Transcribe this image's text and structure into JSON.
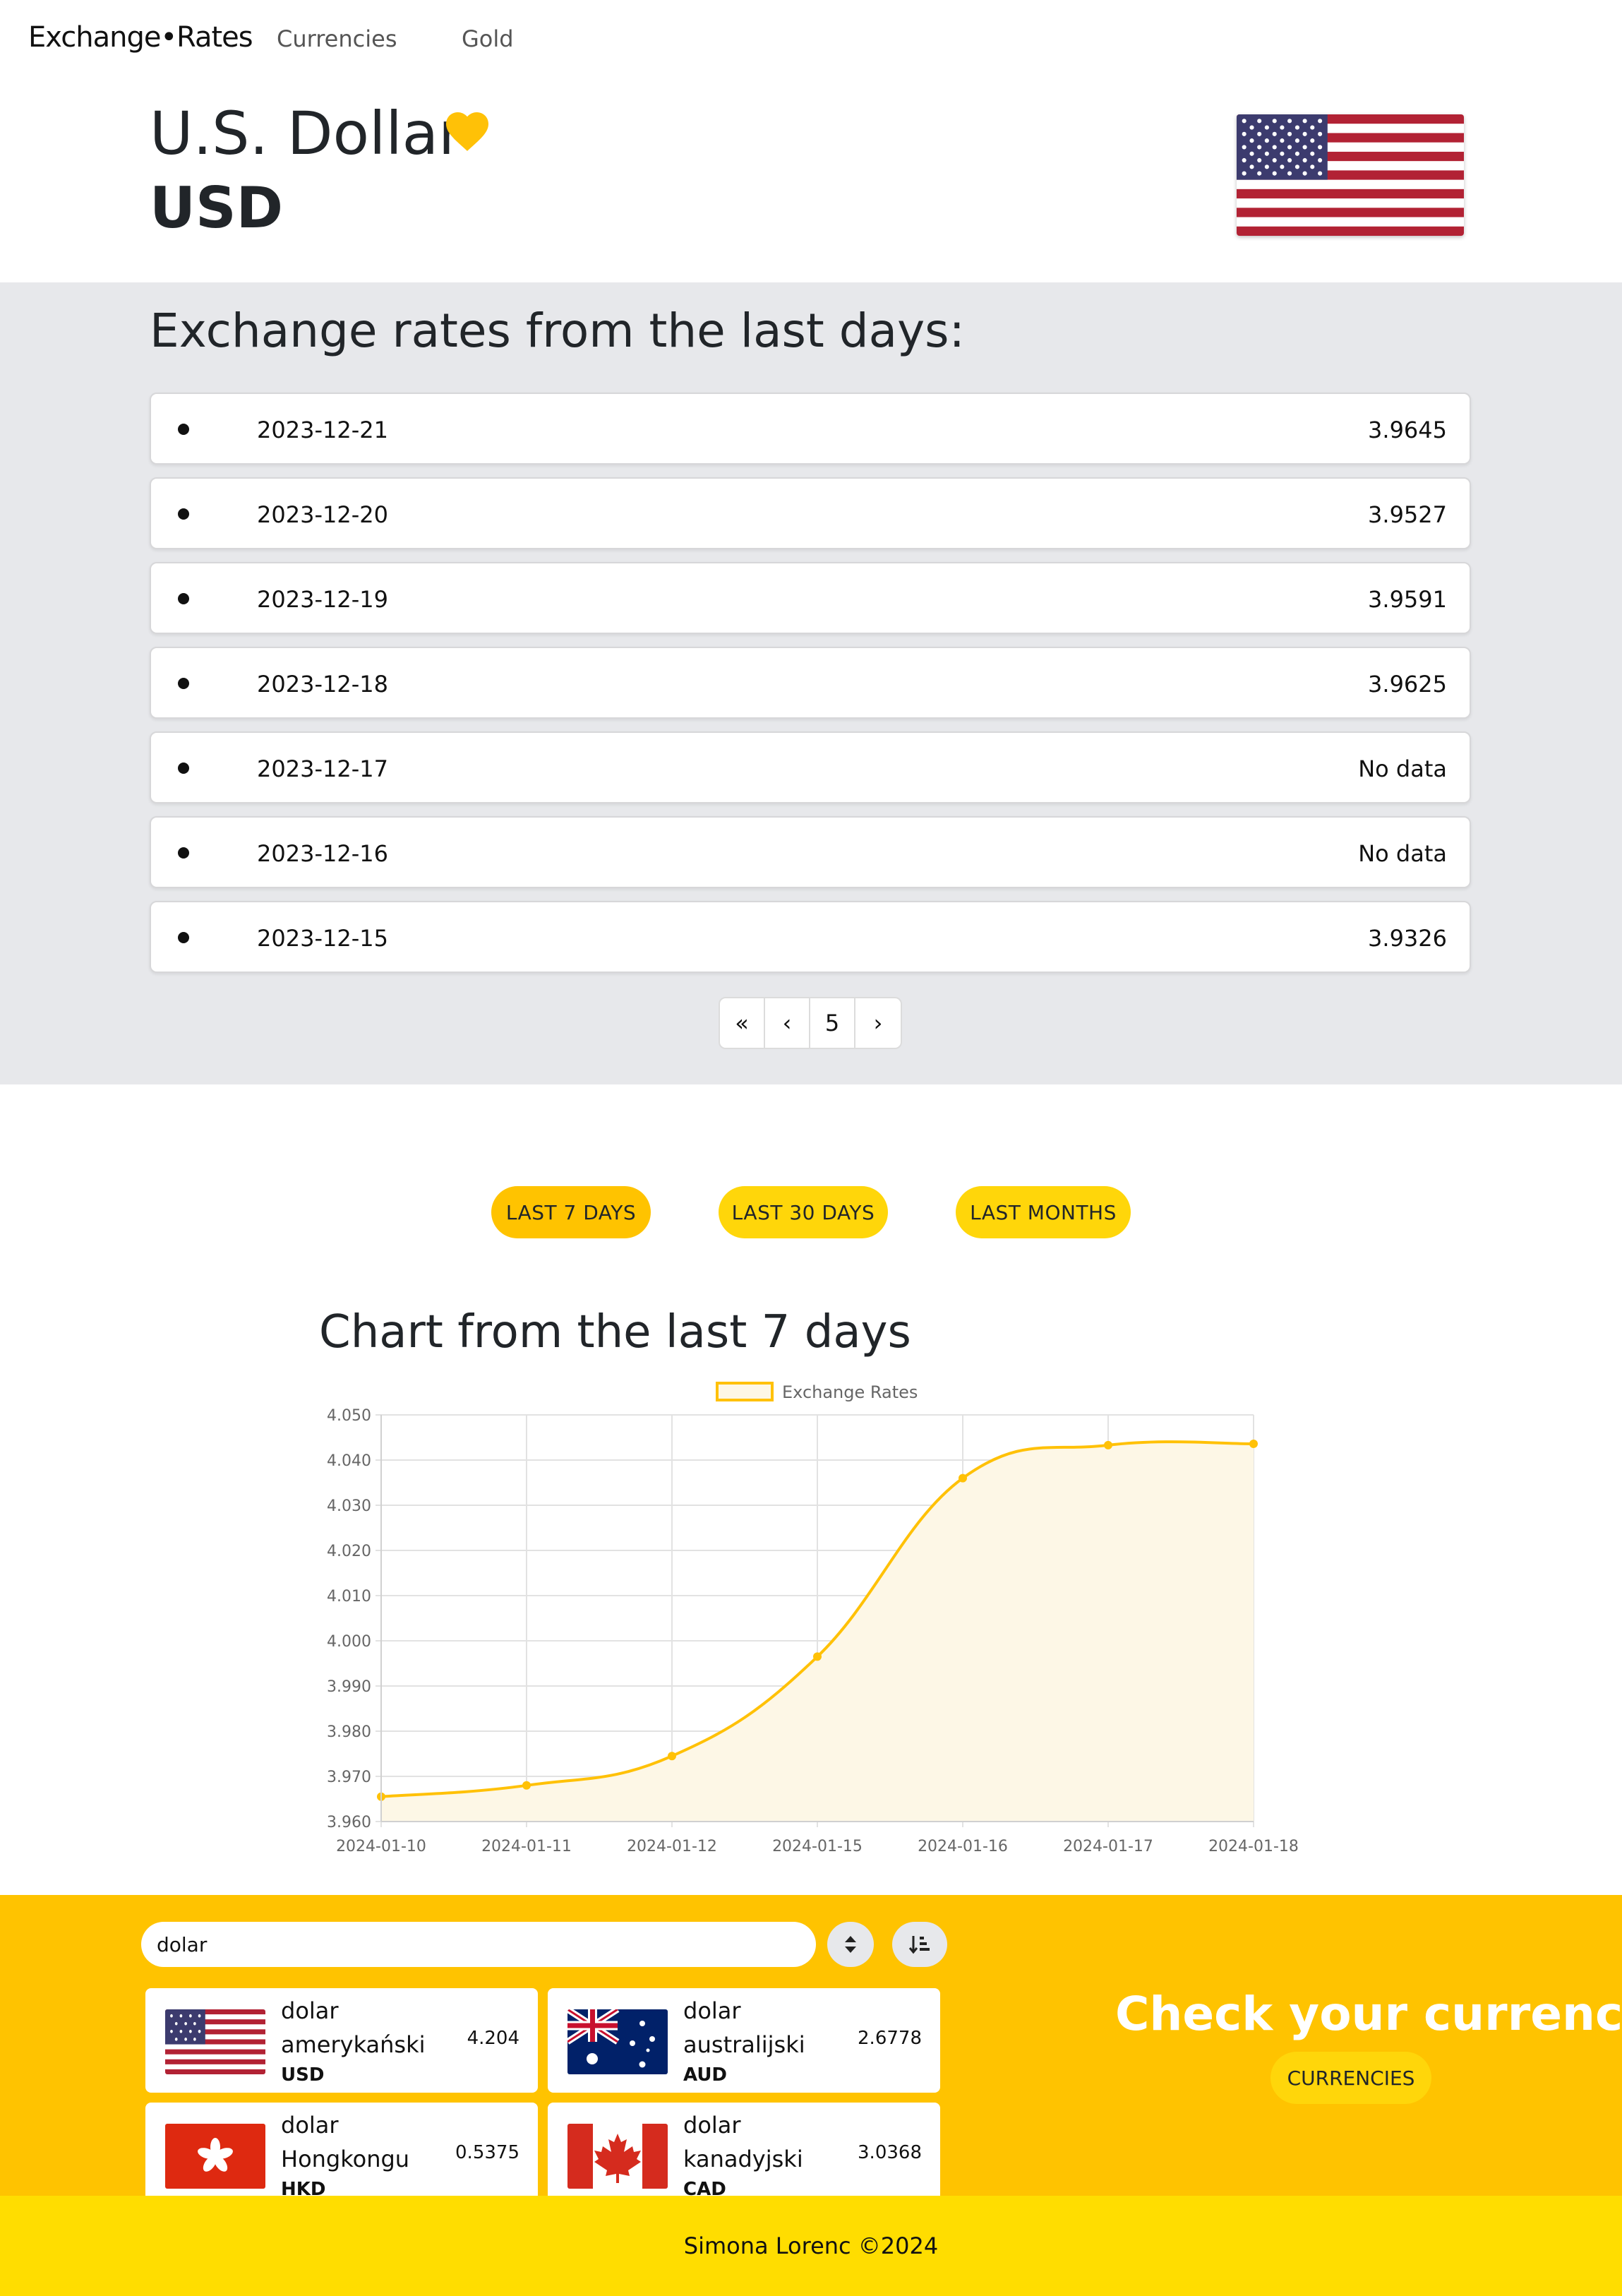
{
  "nav": {
    "brand": "Exchange•Rates",
    "links": [
      "Currencies",
      "Gold"
    ]
  },
  "currency": {
    "name": "U.S. Dollar",
    "code": "USD",
    "flag_icon": "us-flag-icon",
    "favorite_icon": "heart-icon",
    "favorite_color": "#ffc107"
  },
  "rates": {
    "title": "Exchange rates from the last days:",
    "rows": [
      {
        "date": "2023-12-21",
        "value": "3.9645"
      },
      {
        "date": "2023-12-20",
        "value": "3.9527"
      },
      {
        "date": "2023-12-19",
        "value": "3.9591"
      },
      {
        "date": "2023-12-18",
        "value": "3.9625"
      },
      {
        "date": "2023-12-17",
        "value": "No data"
      },
      {
        "date": "2023-12-16",
        "value": "No data"
      },
      {
        "date": "2023-12-15",
        "value": "3.9326"
      }
    ],
    "pagination": {
      "first": "«",
      "prev": "‹",
      "current": "5",
      "next": "›"
    }
  },
  "range_buttons": [
    "LAST 7 DAYS",
    "LAST 30 DAYS",
    "LAST MONTHS"
  ],
  "chart_title": "Chart from the last 7 days",
  "chart_data": {
    "type": "line",
    "series": [
      {
        "name": "Exchange Rates",
        "values": [
          3.9655,
          3.968,
          3.9745,
          3.9965,
          4.036,
          4.0433,
          4.0436
        ]
      }
    ],
    "categories": [
      "2024-01-10",
      "2024-01-11",
      "2024-01-12",
      "2024-01-15",
      "2024-01-16",
      "2024-01-17",
      "2024-01-18"
    ],
    "ylim": [
      3.96,
      4.05
    ],
    "yticks": [
      "4.050",
      "4.040",
      "4.030",
      "4.020",
      "4.010",
      "4.000",
      "3.990",
      "3.980",
      "3.970",
      "3.960"
    ],
    "grid": true,
    "fill": true,
    "legend": "top",
    "line_color": "#ffc107",
    "fill_color": "#fdf7e6"
  },
  "search": {
    "value": "dolar"
  },
  "cards": [
    {
      "name": "dolar amerykański",
      "code": "USD",
      "value": "4.204",
      "flag_icon": "us-flag-icon"
    },
    {
      "name": "dolar australijski",
      "code": "AUD",
      "value": "2.6778",
      "flag_icon": "au-flag-icon"
    },
    {
      "name": "dolar Hongkongu",
      "code": "HKD",
      "value": "0.5375",
      "flag_icon": "hk-flag-icon"
    },
    {
      "name": "dolar kanadyjski",
      "code": "CAD",
      "value": "3.0368",
      "flag_icon": "ca-flag-icon"
    }
  ],
  "cta": {
    "title": "Check your currency!",
    "button": "CURRENCIES"
  },
  "footer": {
    "text": "Simona Lorenc ©2024"
  },
  "colors": {
    "accent": "#ffc300",
    "accent_light": "#ffd60a",
    "footer": "#ffdd00",
    "section_bg": "#e7e8eb"
  }
}
